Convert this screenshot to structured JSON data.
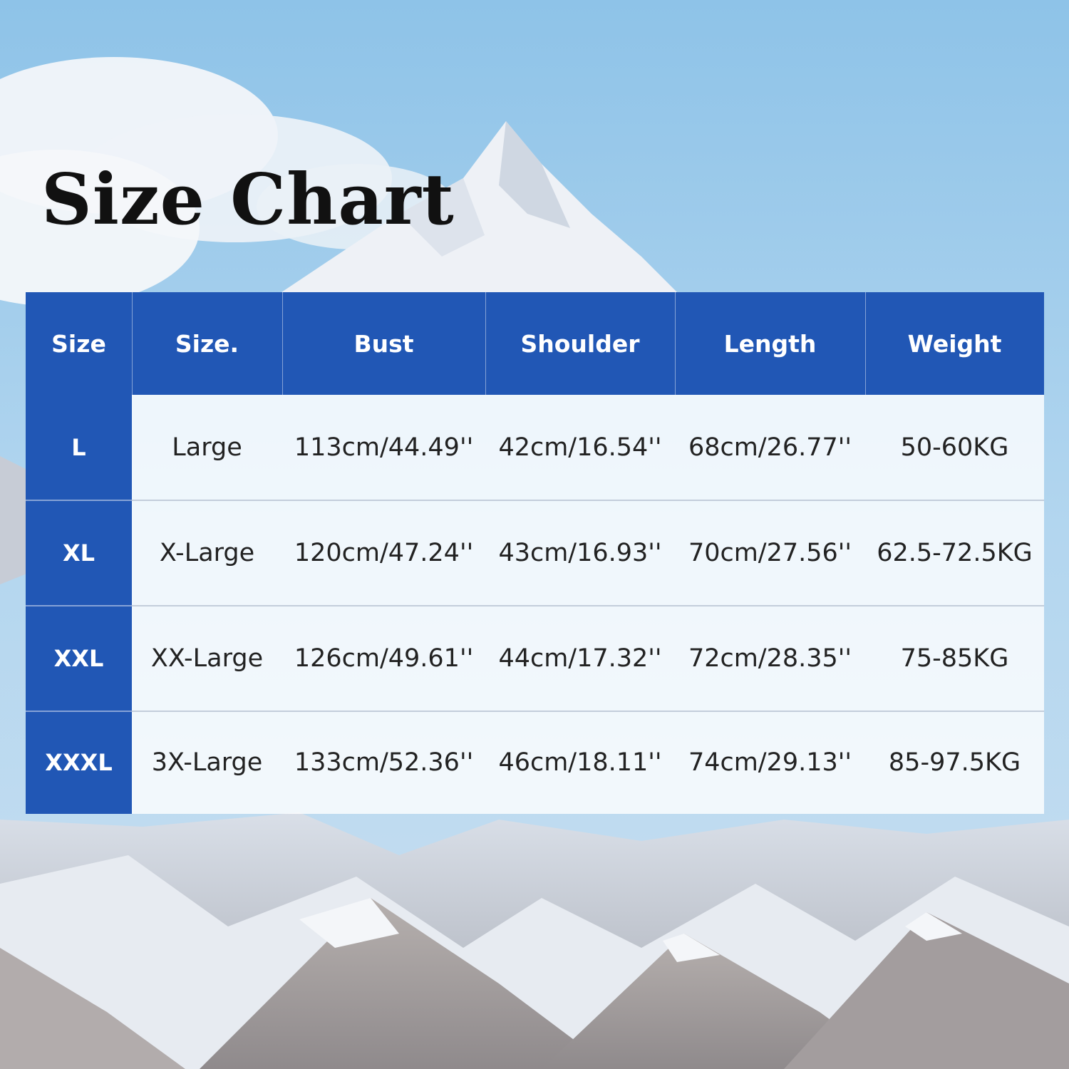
{
  "title": "Size Chart",
  "colors": {
    "header_blue": "#2157b5",
    "sky": "#9cc9e8",
    "text_dark": "#111111"
  },
  "table": {
    "headers": [
      "Size",
      "Size.",
      "Bust",
      "Shoulder",
      "Length",
      "Weight"
    ],
    "rows": [
      [
        "L",
        "Large",
        "113cm/44.49''",
        "42cm/16.54''",
        "68cm/26.77''",
        "50-60KG"
      ],
      [
        "XL",
        "X-Large",
        "120cm/47.24''",
        "43cm/16.93''",
        "70cm/27.56''",
        "62.5-72.5KG"
      ],
      [
        "XXL",
        "XX-Large",
        "126cm/49.61''",
        "44cm/17.32''",
        "72cm/28.35''",
        "75-85KG"
      ],
      [
        "XXXL",
        "3X-Large",
        "133cm/52.36''",
        "46cm/18.11''",
        "74cm/29.13''",
        "85-97.5KG"
      ]
    ]
  }
}
